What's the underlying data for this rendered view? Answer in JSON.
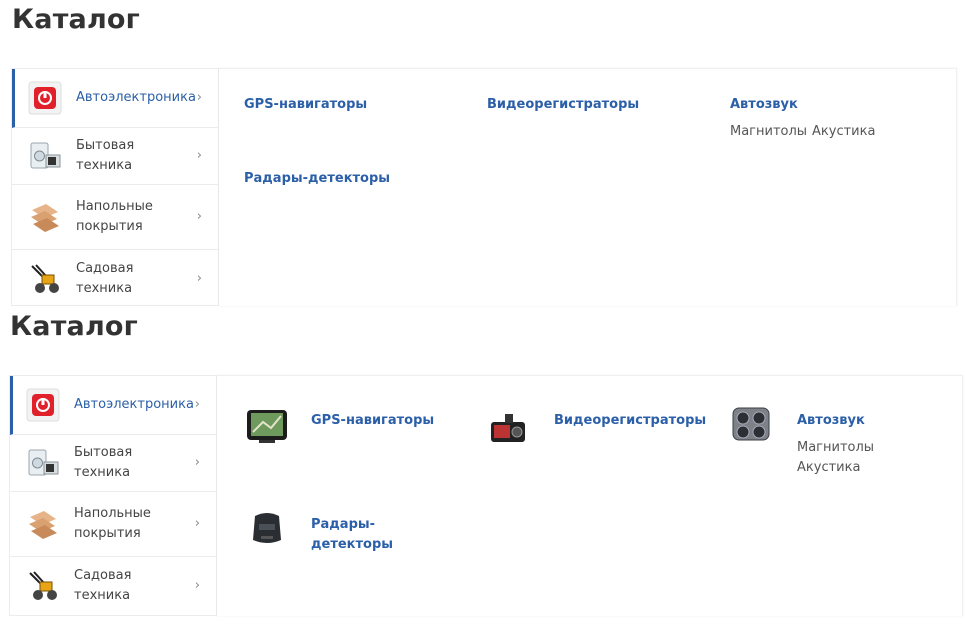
{
  "page_title": "Каталог",
  "sidebar": {
    "items": [
      {
        "label": "Автоэлектроника",
        "icon": "car-audio-icon",
        "active": true
      },
      {
        "label": "Бытовая техника",
        "icon": "appliances-icon",
        "active": false
      },
      {
        "label": "Напольные покрытия",
        "icon": "flooring-icon",
        "active": false
      },
      {
        "label": "Садовая техника",
        "icon": "garden-tiller-icon",
        "active": false
      }
    ]
  },
  "categories": [
    {
      "label": "GPS-навигаторы",
      "icon": "gps-navigator-icon",
      "subs": []
    },
    {
      "label": "Видеорегистраторы",
      "icon": "dashcam-icon",
      "subs": []
    },
    {
      "label": "Автозвук",
      "icon": "car-speaker-icon",
      "subs": [
        "Магнитолы",
        "Акустика"
      ]
    },
    {
      "label": "Радары-детекторы",
      "icon": "radar-detector-icon",
      "subs": []
    }
  ],
  "variant2": {
    "radar_label_line1": "Радары-",
    "radar_label_line2": "детекторы"
  },
  "colors": {
    "accent": "#2b5fa8",
    "text": "#444444",
    "border": "#ececec"
  }
}
